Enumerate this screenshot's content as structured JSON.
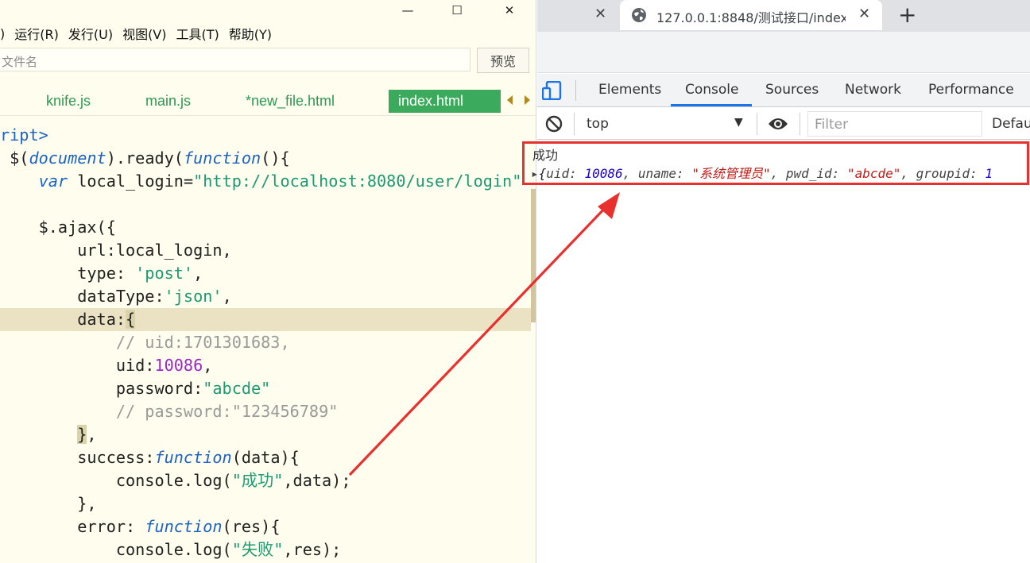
{
  "editor": {
    "window_controls": [
      "—",
      "☐",
      "✕"
    ],
    "menu": [
      ")",
      "运行(R)",
      "发行(U)",
      "视图(V)",
      "工具(T)",
      "帮助(Y)"
    ],
    "file_placeholder": "文件名",
    "preview_label": "预览",
    "tabs": [
      "knife.js",
      "main.js",
      "*new_file.html",
      "index.html"
    ],
    "code_lines": [
      "ript>",
      " $(document).ready(function(){",
      "     var local_login=\"http://localhost:8080/user/login\"",
      "",
      "     $.ajax({",
      "         url:local_login,",
      "         type: 'post',",
      "         dataType:'json',",
      "         data:{",
      "             // uid:1701301683,",
      "             uid:10086,",
      "             password:\"abcde\"",
      "             // password:\"123456789\"",
      "         },",
      "         success:function(data){",
      "             console.log(\"成功\",data);",
      "         },",
      "         error: function(res){",
      "             console.log(\"失败\",res);"
    ]
  },
  "browser": {
    "tabs": [
      {
        "title": "",
        "close": "✕"
      },
      {
        "title": "127.0.0.1:8848/测试接口/index",
        "close": "✕"
      }
    ],
    "new_tab": "+",
    "devtools": {
      "tabs": [
        "Elements",
        "Console",
        "Sources",
        "Network",
        "Performance"
      ],
      "active_tab": "Console",
      "context": "top",
      "filter_placeholder": "Filter",
      "levels": "Defau",
      "output": {
        "line1": "成功",
        "line2": {
          "prefix": "▸",
          "uid_key": "uid: ",
          "uid_val": "10086",
          "uname_key": ", uname: ",
          "uname_val": "\"系统管理员\"",
          "pwd_key": ", pwd_id: ",
          "pwd_val": "\"abcde\"",
          "group_key": ", groupid: ",
          "group_val": "1"
        }
      }
    }
  }
}
